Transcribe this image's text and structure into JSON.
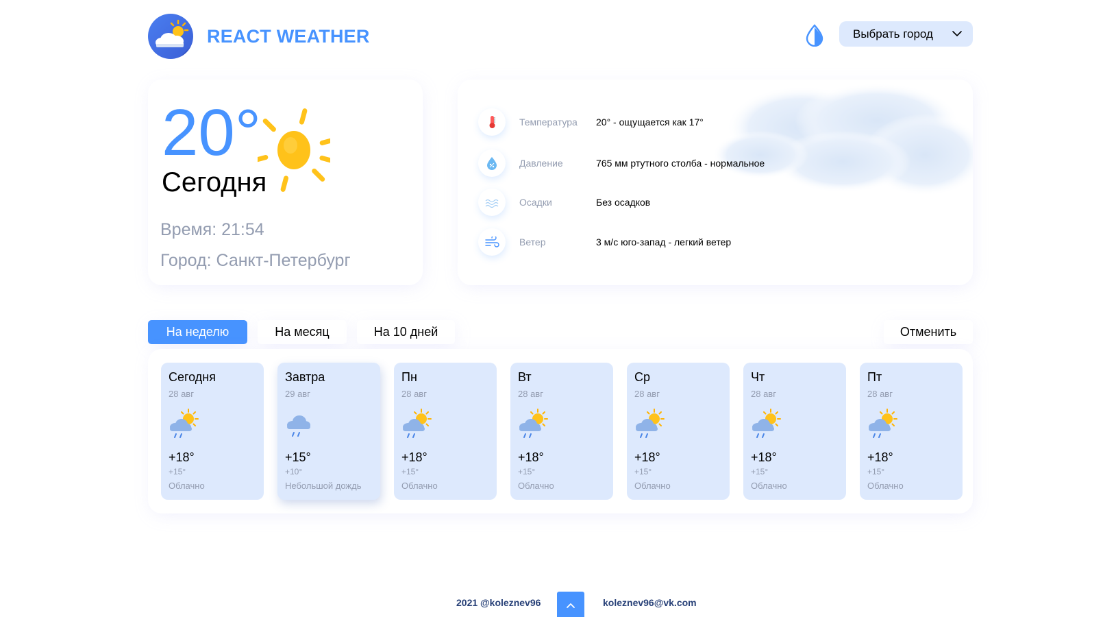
{
  "header": {
    "app_title": "REACT WEATHER",
    "city_select_value": "Выбрать город"
  },
  "today": {
    "temperature": "20°",
    "label": "Сегодня",
    "time": "Время: 21:54",
    "city": "Город: Санкт-Петербург"
  },
  "details": [
    {
      "icon": "thermometer-icon",
      "label": "Температура",
      "value": "20° - ощущается как 17°"
    },
    {
      "icon": "pressure-drop-icon",
      "label": "Давление",
      "value": "765 мм ртутного столба - нормальное"
    },
    {
      "icon": "precipitation-icon",
      "label": "Осадки",
      "value": "Без осадков"
    },
    {
      "icon": "wind-icon",
      "label": "Ветер",
      "value": "3 м/с юго-запад - легкий ветер"
    }
  ],
  "tabs": {
    "week": "На неделю",
    "month": "На месяц",
    "ten_days": "На 10 дней",
    "cancel": "Отменить",
    "active": "week"
  },
  "forecast": [
    {
      "day": "Сегодня",
      "date": "28 авг",
      "icon": "sun-cloud-rain-icon",
      "max": "+18°",
      "min": "+15°",
      "desc": "Облачно"
    },
    {
      "day": "Завтра",
      "date": "29 авг",
      "icon": "cloud-rain-icon",
      "max": "+15°",
      "min": "+10°",
      "desc": "Небольшой дождь"
    },
    {
      "day": "Пн",
      "date": "28 авг",
      "icon": "sun-cloud-rain-icon",
      "max": "+18°",
      "min": "+15°",
      "desc": "Облачно"
    },
    {
      "day": "Вт",
      "date": "28 авг",
      "icon": "sun-cloud-rain-icon",
      "max": "+18°",
      "min": "+15°",
      "desc": "Облачно"
    },
    {
      "day": "Ср",
      "date": "28 авг",
      "icon": "sun-cloud-rain-icon",
      "max": "+18°",
      "min": "+15°",
      "desc": "Облачно"
    },
    {
      "day": "Чт",
      "date": "28 авг",
      "icon": "sun-cloud-rain-icon",
      "max": "+18°",
      "min": "+15°",
      "desc": "Облачно"
    },
    {
      "day": "Пт",
      "date": "28 авг",
      "icon": "sun-cloud-rain-icon",
      "max": "+18°",
      "min": "+15°",
      "desc": "Облачно"
    }
  ],
  "footer": {
    "left": "2021 @koleznev96",
    "right": "koleznev96@vk.com"
  },
  "colors": {
    "accent": "#4793ff",
    "card_bg": "#dde9fd",
    "muted_text": "#939cb0",
    "sun": "#ffc21a"
  }
}
